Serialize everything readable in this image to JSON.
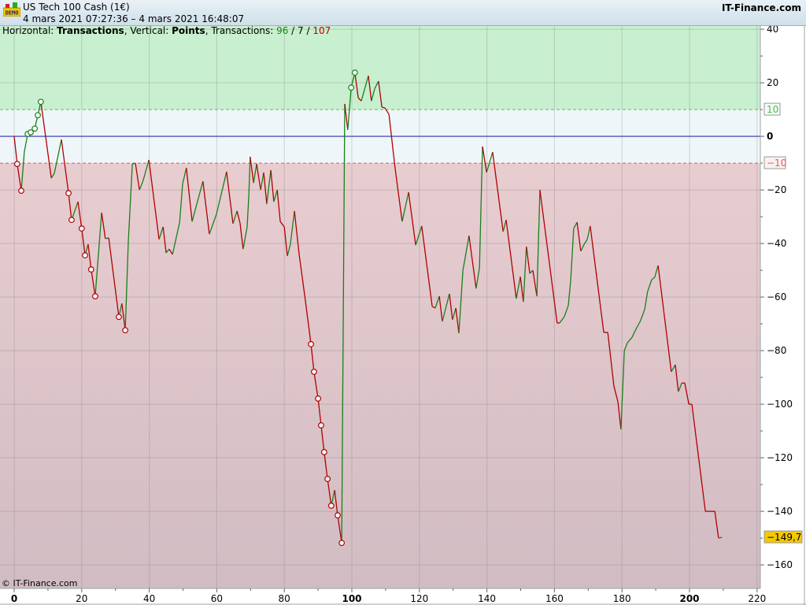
{
  "header": {
    "logo_text": "DEMO",
    "title": "US Tech 100 Cash (1€)",
    "period": "4 mars 2021 07:27:36 – 4 mars 2021 16:48:07",
    "brand": "IT-Finance.com"
  },
  "info": {
    "h_label": "Horizontal: ",
    "h_value": "Transactions",
    "v_label": ", Vertical: ",
    "v_value": "Points",
    "t_label": ", Transactions: ",
    "t_up": "96",
    "sep1": " / ",
    "t_flat": "7",
    "sep2": " / ",
    "t_down": "107"
  },
  "copyright": "© IT-Finance.com",
  "colors": {
    "up": "#1a7f1a",
    "down": "#b00000",
    "zone_up": "#c8efcf",
    "zone_mid": "#eff6f9",
    "zone_down_top": "#e8cdd0",
    "zone_down_bottom": "#d1bcc3",
    "zero_line": "#2b2fb0",
    "last_box": "#f5c800"
  },
  "chart_data": {
    "type": "line",
    "xlabel": "Transactions",
    "ylabel": "Points",
    "xlim": [
      0,
      222
    ],
    "ylim": [
      -168.8,
      41.2
    ],
    "x_ticks": [
      0,
      20,
      40,
      60,
      80,
      100,
      120,
      140,
      160,
      180,
      200,
      220
    ],
    "x_tick_labels": [
      "0",
      "20",
      "40",
      "60",
      "80",
      "100",
      "120",
      "140",
      "160",
      "180",
      "200",
      "220"
    ],
    "y_ticks": [
      40,
      20,
      0,
      -20,
      -40,
      -60,
      -80,
      -100,
      -120,
      -140,
      -160
    ],
    "y_tick_labels": [
      "40",
      "20",
      "0",
      "−20",
      "−40",
      "−60",
      "−80",
      "−100",
      "−120",
      "−140",
      "−160"
    ],
    "upper_threshold": 10,
    "lower_threshold": -10,
    "upper_threshold_label": "10",
    "lower_threshold_label": "−10",
    "last_value": -149.7,
    "last_value_label": "−149,7",
    "grid": true,
    "points": [
      [
        0,
        0,
        0
      ],
      [
        0.9,
        -10.3,
        1
      ],
      [
        2.1,
        -20.3,
        1
      ],
      [
        3.0,
        -5.9,
        0
      ],
      [
        4.0,
        0.9,
        1
      ],
      [
        4.9,
        1.5,
        1
      ],
      [
        6.1,
        2.9,
        1
      ],
      [
        7.0,
        7.9,
        1
      ],
      [
        7.9,
        12.9,
        1
      ],
      [
        11.0,
        -15.6,
        0
      ],
      [
        11.9,
        -13.8,
        0
      ],
      [
        14.0,
        -1.2,
        0
      ],
      [
        16.1,
        -21.2,
        1
      ],
      [
        17.0,
        -31.2,
        1
      ],
      [
        18.9,
        -24.4,
        0
      ],
      [
        20.0,
        -34.4,
        1
      ],
      [
        21.0,
        -44.4,
        1
      ],
      [
        21.9,
        -40.3,
        0
      ],
      [
        22.8,
        -49.7,
        1
      ],
      [
        24.0,
        -59.7,
        1
      ],
      [
        25.9,
        -28.5,
        0
      ],
      [
        27.0,
        -38.2,
        0
      ],
      [
        28.0,
        -37.9,
        0
      ],
      [
        31.0,
        -67.4,
        1
      ],
      [
        31.9,
        -62.4,
        0
      ],
      [
        32.9,
        -72.4,
        1
      ],
      [
        33.8,
        -39.4,
        0
      ],
      [
        35.0,
        -10.3,
        0
      ],
      [
        35.9,
        -10.0,
        0
      ],
      [
        37.1,
        -20.0,
        0
      ],
      [
        38.2,
        -16.5,
        0
      ],
      [
        39.9,
        -8.8,
        0
      ],
      [
        42.9,
        -38.5,
        0
      ],
      [
        44.1,
        -33.8,
        0
      ],
      [
        45.0,
        -43.5,
        0
      ],
      [
        45.9,
        -42.1,
        0
      ],
      [
        46.9,
        -44.1,
        0
      ],
      [
        49.0,
        -32.1,
        0
      ],
      [
        49.9,
        -17.6,
        0
      ],
      [
        51.0,
        -11.8,
        0
      ],
      [
        52.7,
        -31.8,
        0
      ],
      [
        55.9,
        -16.8,
        0
      ],
      [
        57.8,
        -36.5,
        0
      ],
      [
        59.9,
        -29.1,
        0
      ],
      [
        61.8,
        -19.1,
        0
      ],
      [
        62.9,
        -13.2,
        0
      ],
      [
        64.8,
        -32.6,
        0
      ],
      [
        66.0,
        -27.9,
        0
      ],
      [
        66.9,
        -32.4,
        0
      ],
      [
        67.8,
        -42.1,
        0
      ],
      [
        69.0,
        -33.8,
        0
      ],
      [
        69.5,
        -21.8,
        0
      ],
      [
        69.9,
        -7.6,
        0
      ],
      [
        70.9,
        -17.4,
        0
      ],
      [
        71.8,
        -10.3,
        0
      ],
      [
        73.0,
        -20.0,
        0
      ],
      [
        73.9,
        -13.5,
        0
      ],
      [
        74.8,
        -25.3,
        0
      ],
      [
        76.0,
        -12.6,
        0
      ],
      [
        76.9,
        -24.4,
        0
      ],
      [
        77.9,
        -20.0,
        0
      ],
      [
        78.8,
        -31.8,
        0
      ],
      [
        80.0,
        -33.8,
        0
      ],
      [
        80.9,
        -44.7,
        0
      ],
      [
        81.8,
        -40.3,
        0
      ],
      [
        83.0,
        -27.9,
        0
      ],
      [
        84.4,
        -44.1,
        0
      ],
      [
        86.2,
        -60.9,
        0
      ],
      [
        87.9,
        -77.6,
        1
      ],
      [
        88.8,
        -87.9,
        1
      ],
      [
        90.0,
        -97.9,
        1
      ],
      [
        90.9,
        -107.9,
        1
      ],
      [
        91.8,
        -117.9,
        1
      ],
      [
        92.8,
        -127.9,
        1
      ],
      [
        93.9,
        -137.9,
        1
      ],
      [
        94.9,
        -132.1,
        0
      ],
      [
        95.8,
        -141.5,
        1
      ],
      [
        97.0,
        -151.8,
        1
      ],
      [
        97.9,
        12.1,
        0
      ],
      [
        98.8,
        2.4,
        0
      ],
      [
        99.8,
        18.2,
        1
      ],
      [
        100.9,
        23.8,
        1
      ],
      [
        101.9,
        14.4,
        0
      ],
      [
        102.8,
        13.2,
        0
      ],
      [
        104.9,
        22.6,
        0
      ],
      [
        105.8,
        13.2,
        0
      ],
      [
        106.8,
        17.9,
        0
      ],
      [
        107.9,
        20.6,
        0
      ],
      [
        108.9,
        10.9,
        0
      ],
      [
        109.8,
        10.6,
        0
      ],
      [
        111.0,
        8.2,
        0
      ],
      [
        112.8,
        -11.8,
        0
      ],
      [
        114.9,
        -31.8,
        0
      ],
      [
        116.8,
        -20.9,
        0
      ],
      [
        118.9,
        -40.6,
        0
      ],
      [
        120.7,
        -33.5,
        0
      ],
      [
        123.8,
        -63.5,
        0
      ],
      [
        124.7,
        -64.1,
        0
      ],
      [
        125.9,
        -59.7,
        0
      ],
      [
        126.8,
        -69.1,
        0
      ],
      [
        128.9,
        -58.8,
        0
      ],
      [
        129.8,
        -68.5,
        0
      ],
      [
        130.8,
        -64.1,
        0
      ],
      [
        131.7,
        -73.5,
        0
      ],
      [
        132.9,
        -50.0,
        0
      ],
      [
        134.7,
        -37.1,
        0
      ],
      [
        136.8,
        -56.8,
        0
      ],
      [
        137.8,
        -49.1,
        0
      ],
      [
        138.7,
        -3.8,
        0
      ],
      [
        139.9,
        -13.5,
        0
      ],
      [
        141.7,
        -5.9,
        0
      ],
      [
        144.8,
        -35.6,
        0
      ],
      [
        145.7,
        -31.2,
        0
      ],
      [
        148.7,
        -60.6,
        0
      ],
      [
        149.9,
        -52.4,
        0
      ],
      [
        150.8,
        -61.8,
        0
      ],
      [
        151.7,
        -41.2,
        0
      ],
      [
        152.7,
        -51.2,
        0
      ],
      [
        153.6,
        -50.0,
        0
      ],
      [
        154.8,
        -59.7,
        0
      ],
      [
        155.7,
        -20.0,
        0
      ],
      [
        160.8,
        -69.7,
        0
      ],
      [
        161.5,
        -69.7,
        0
      ],
      [
        162.9,
        -67.4,
        0
      ],
      [
        164.1,
        -63.2,
        0
      ],
      [
        164.8,
        -54.1,
        0
      ],
      [
        165.7,
        -34.4,
        0
      ],
      [
        166.7,
        -32.1,
        0
      ],
      [
        167.8,
        -42.9,
        0
      ],
      [
        168.8,
        -40.3,
        0
      ],
      [
        169.7,
        -38.5,
        0
      ],
      [
        170.6,
        -33.5,
        0
      ],
      [
        174.6,
        -73.2,
        0
      ],
      [
        175.8,
        -73.2,
        0
      ],
      [
        177.6,
        -93.2,
        0
      ],
      [
        178.8,
        -99.1,
        0
      ],
      [
        179.7,
        -109.4,
        0
      ],
      [
        180.7,
        -80.0,
        0
      ],
      [
        181.6,
        -77.1,
        0
      ],
      [
        183.0,
        -75.0,
        0
      ],
      [
        183.9,
        -72.6,
        0
      ],
      [
        185.5,
        -68.8,
        0
      ],
      [
        186.7,
        -64.7,
        0
      ],
      [
        187.6,
        -57.9,
        0
      ],
      [
        188.8,
        -53.5,
        0
      ],
      [
        189.7,
        -52.6,
        0
      ],
      [
        190.7,
        -48.2,
        0
      ],
      [
        194.6,
        -87.9,
        0
      ],
      [
        195.8,
        -85.3,
        0
      ],
      [
        196.7,
        -95.3,
        0
      ],
      [
        197.7,
        -92.1,
        0
      ],
      [
        198.6,
        -92.1,
        0
      ],
      [
        199.8,
        -100.0,
        0
      ],
      [
        200.7,
        -100.0,
        0
      ],
      [
        204.7,
        -140.0,
        0
      ],
      [
        207.5,
        -140.0,
        0
      ],
      [
        208.6,
        -150.0,
        0
      ],
      [
        209.6,
        -149.7,
        0
      ]
    ]
  }
}
